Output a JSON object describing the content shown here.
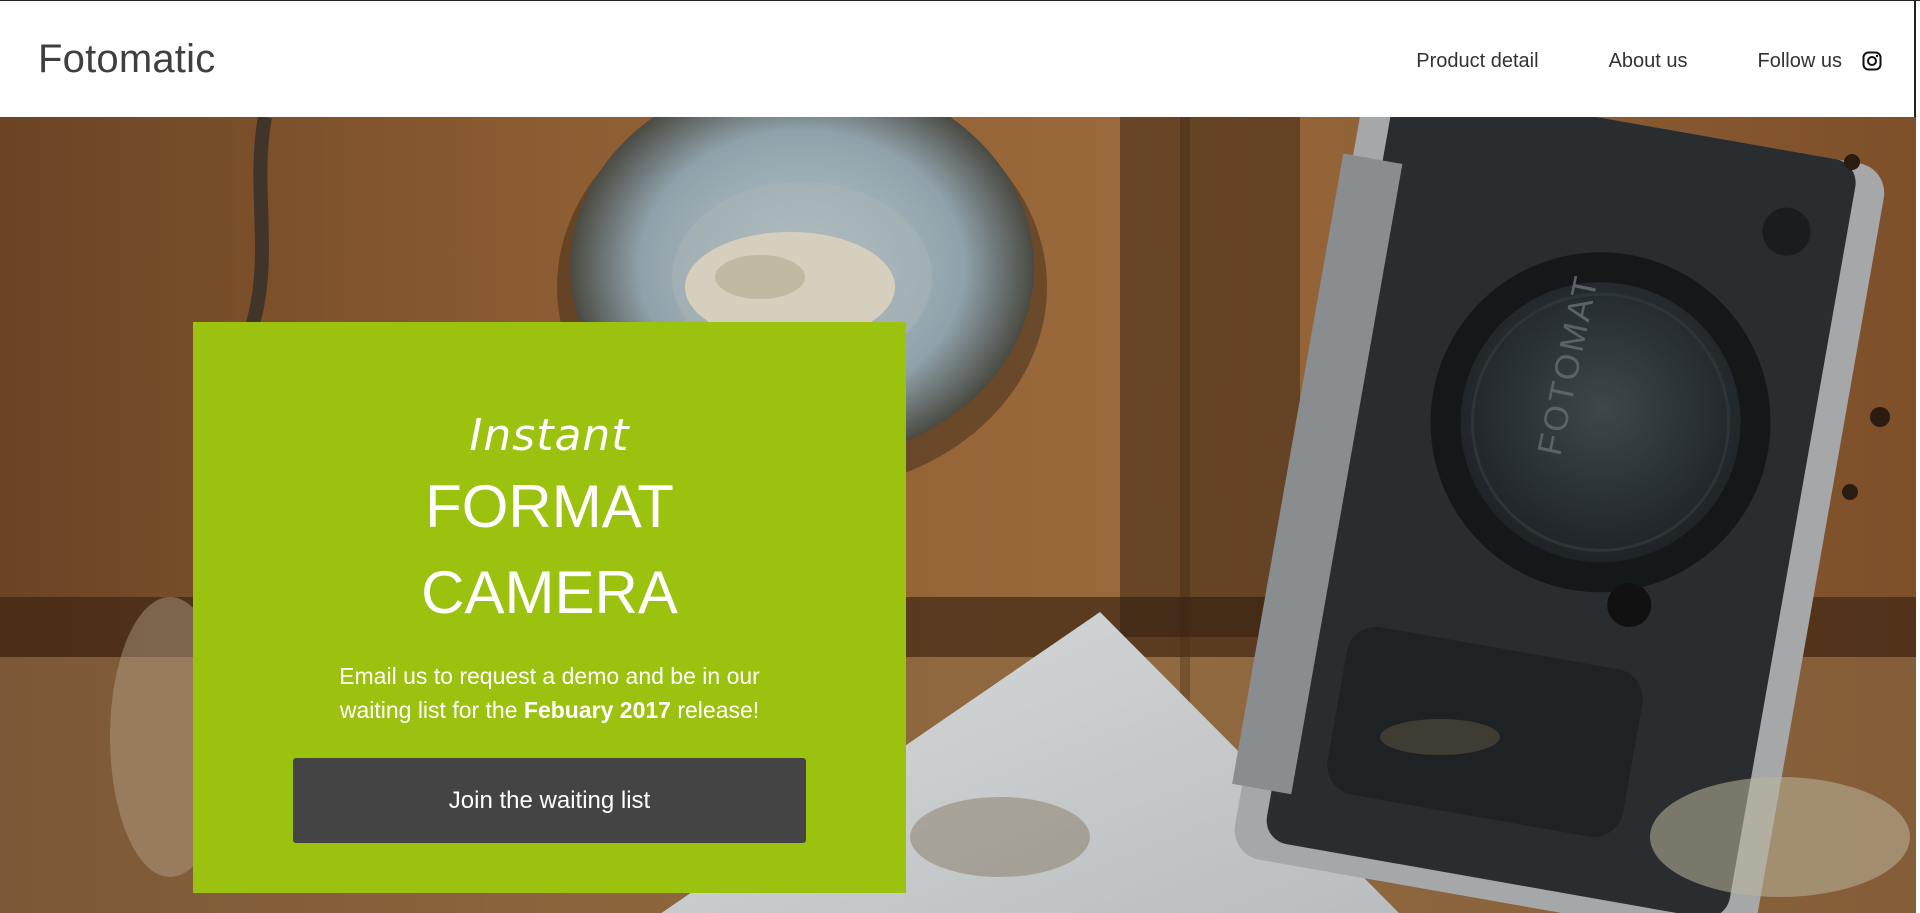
{
  "header": {
    "brand": "Fotomatic",
    "nav": {
      "product_detail": "Product detail",
      "about_us": "About us",
      "follow_us": "Follow us"
    },
    "social_icon": "instagram-icon"
  },
  "hero": {
    "background_description_icon": "camera-photo",
    "card": {
      "kicker": "Instant",
      "title_line1": "FORMAT",
      "title_line2": "CAMERA",
      "description_part1": "Email us to request a demo and be in our waiting list for the ",
      "description_bold": "Febuary 2017",
      "description_part2": " release!",
      "cta_label": "Join the waiting list"
    },
    "camera_cap_text": "FOTOMAT"
  },
  "colors": {
    "card_green": "#9bc20e",
    "button_dark": "#444444",
    "wood": "#8a5a30"
  }
}
